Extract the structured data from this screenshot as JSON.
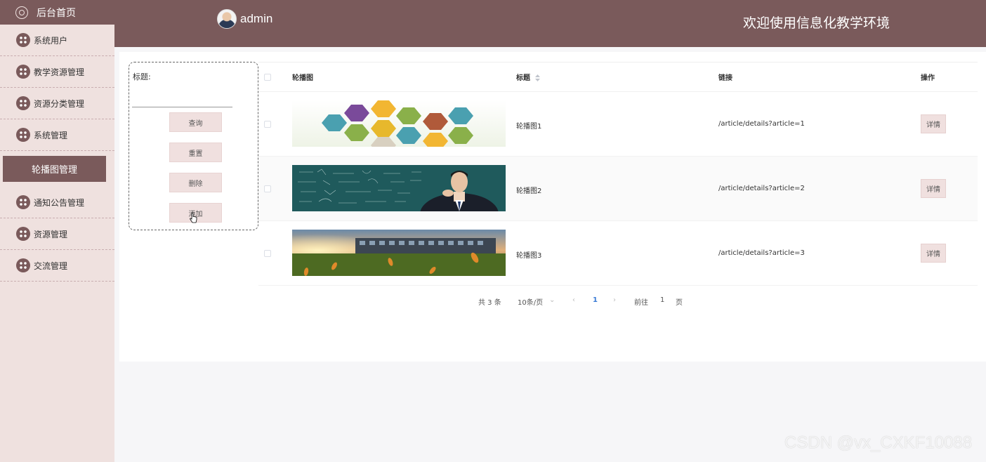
{
  "sidebar": {
    "home_label": "后台首页",
    "items": [
      {
        "label": "系统用户"
      },
      {
        "label": "教学资源管理"
      },
      {
        "label": "资源分类管理"
      },
      {
        "label": "系统管理"
      }
    ],
    "active_label": "轮播图管理",
    "items_after": [
      {
        "label": "通知公告管理"
      },
      {
        "label": "资源管理"
      },
      {
        "label": "交流管理"
      }
    ]
  },
  "header": {
    "username": "admin",
    "welcome": "欢迎使用信息化教学环境"
  },
  "search": {
    "label": "标题:",
    "value": "",
    "placeholder": "",
    "query_label": "查询",
    "reset_label": "重置",
    "delete_label": "删除",
    "add_label": "添加"
  },
  "table": {
    "columns": {
      "image": "轮播图",
      "title": "标题",
      "link": "链接",
      "action": "操作"
    },
    "rows": [
      {
        "title": "轮播图1",
        "link": "/article/details?article=1",
        "action": "详情",
        "image": "hexagon-banner"
      },
      {
        "title": "轮播图2",
        "link": "/article/details?article=2",
        "action": "详情",
        "image": "blackboard-man"
      },
      {
        "title": "轮播图3",
        "link": "/article/details?article=3",
        "action": "详情",
        "image": "campus-grass-sunset"
      }
    ]
  },
  "pagination": {
    "total": "共 3 条",
    "page_size": "10条/页",
    "current_page": "1",
    "goto_prefix": "前往",
    "goto_value": "1",
    "goto_suffix": "页"
  },
  "watermark": "CSDN @vx_CXKF10088",
  "colors": {
    "brand": "#7a5a5b",
    "sidebar_bg": "#efe1df",
    "button_bg": "#f0e0df",
    "pager_active": "#3a7bd5"
  }
}
